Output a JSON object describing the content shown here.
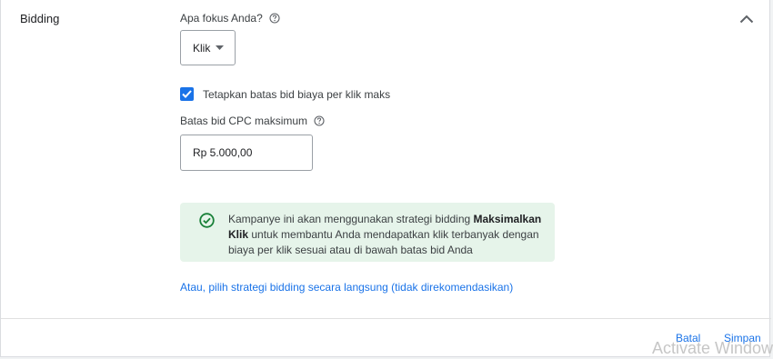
{
  "section": {
    "title": "Bidding"
  },
  "focus": {
    "question": "Apa fokus Anda?",
    "selected": "Klik"
  },
  "max_cpc_checkbox": {
    "checked": true,
    "label": "Tetapkan batas bid biaya per klik maks"
  },
  "cpc": {
    "label": "Batas bid CPC maksimum",
    "value": "Rp 5.000,00"
  },
  "info": {
    "text_before": "Kampanye ini akan menggunakan strategi bidding ",
    "strategy_name": "Maksimalkan Klik",
    "text_after": " untuk membantu Anda mendapatkan klik terbanyak dengan biaya per klik sesuai atau di bawah batas bid Anda"
  },
  "manual_link": "Atau, pilih strategi bidding secara langsung (tidak direkomendasikan)",
  "footer": {
    "cancel_label": "Batal",
    "save_label": "Simpan"
  },
  "watermark": "Activate Windows",
  "colors": {
    "accent": "#1a73e8",
    "success_bg": "#e6f4ea",
    "success_icon": "#188038"
  },
  "icons": [
    "chevron-up-icon",
    "help-icon",
    "dropdown-arrow-icon",
    "check-icon",
    "check-circle-icon"
  ]
}
